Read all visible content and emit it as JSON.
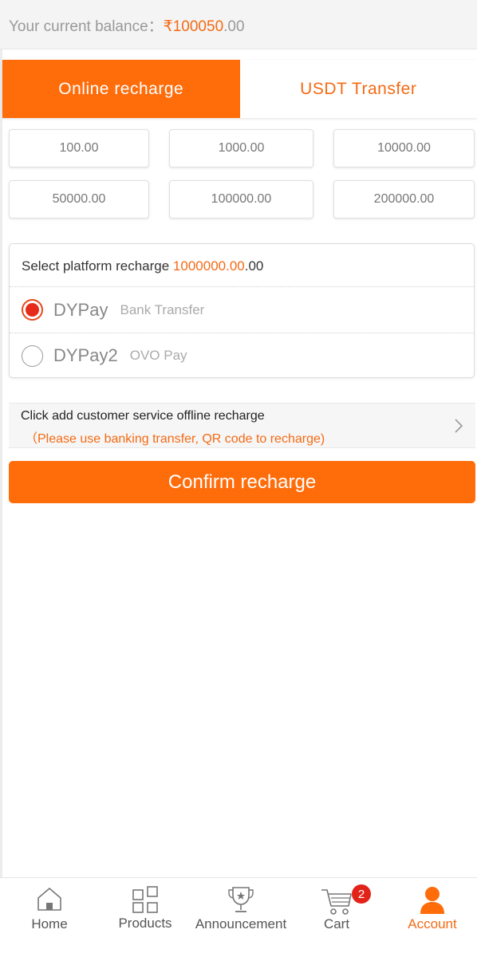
{
  "balance": {
    "label": "Your current balance：",
    "currency": "₹",
    "amount": "100050",
    "decimals": ".00"
  },
  "tabs": [
    {
      "label": "Online recharge",
      "active": true
    },
    {
      "label": "USDT Transfer",
      "active": false
    }
  ],
  "amounts": [
    "100.00",
    "1000.00",
    "10000.00",
    "50000.00",
    "100000.00",
    "200000.00"
  ],
  "platform": {
    "title_prefix": "Select platform recharge ",
    "title_amount": "1000000.00",
    "title_suffix": ".00",
    "options": [
      {
        "name": "DYPay",
        "sub": "Bank Transfer",
        "selected": true
      },
      {
        "name": "DYPay2",
        "sub": "OVO Pay",
        "selected": false
      }
    ]
  },
  "customer_service": {
    "line1": "Click add customer service offline recharge",
    "line2": "（Please use banking transfer, QR code to recharge)",
    "icon": "chevron-right-icon"
  },
  "confirm_label": "Confirm recharge",
  "nav": {
    "items": [
      {
        "label": "Home",
        "icon": "home-icon"
      },
      {
        "label": "Products",
        "icon": "grid-icon"
      },
      {
        "label": "Announcement",
        "icon": "trophy-icon"
      },
      {
        "label": "Cart",
        "icon": "cart-icon",
        "badge": "2"
      },
      {
        "label": "Account",
        "icon": "user-icon",
        "active": true
      }
    ]
  },
  "colors": {
    "accent": "#ff6c0a",
    "badge": "#e2231a",
    "radio_selected": "#e62b1a"
  }
}
